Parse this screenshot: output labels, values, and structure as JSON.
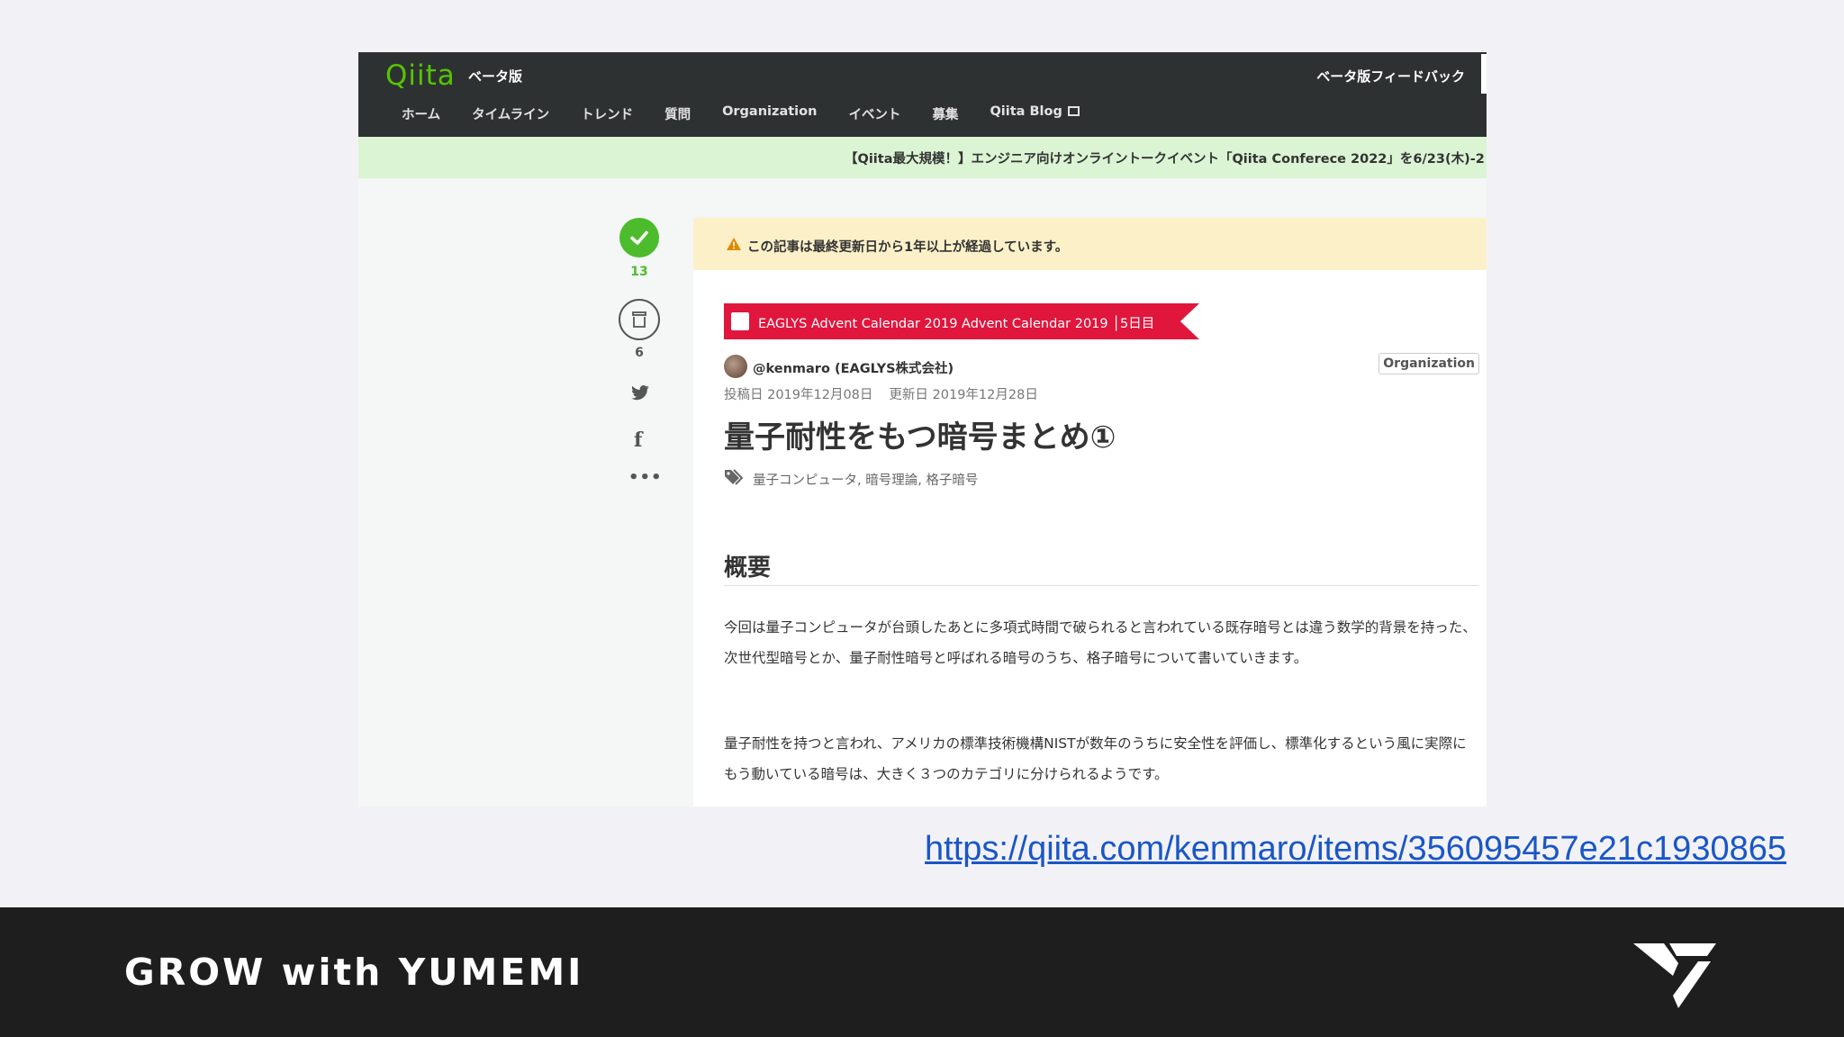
{
  "qiita": {
    "logo": "Qiita",
    "beta": "ベータ版",
    "feedback": "ベータ版フィードバック",
    "nav": [
      "ホーム",
      "タイムライン",
      "トレンド",
      "質問",
      "Organization",
      "イベント",
      "募集",
      "Qiita Blog"
    ],
    "announcement": "【Qiita最大規模！】エンジニア向けオンライントークイベント「Qiita Conferece 2022」を6/23(木)-2"
  },
  "sidebar": {
    "like_count": "13",
    "stock_count": "6"
  },
  "article": {
    "warning": "この記事は最終更新日から1年以上が経過しています。",
    "advent": "EAGLYS Advent Calendar 2019 Advent Calendar 2019 │5日目",
    "author": "@kenmaro (EAGLYS株式会社)",
    "org_badge": "Organization",
    "posted": "投稿日 2019年12月08日",
    "updated": "更新日 2019年12月28日",
    "title": "量子耐性をもつ暗号まとめ①",
    "tags": "量子コンピュータ, 暗号理論, 格子暗号",
    "section_heading": "概要",
    "paragraph1": "今回は量子コンピュータが台頭したあとに多項式時間で破られると言われている既存暗号とは違う数学的背景を持った、次世代型暗号とか、量子耐性暗号と呼ばれる暗号のうち、格子暗号について書いていきます。",
    "paragraph2": "量子耐性を持つと言われ、アメリカの標準技術機構NISTが数年のうちに安全性を評価し、標準化するという風に実際にもう動いている暗号は、大きく３つのカテゴリに分けられるようです。"
  },
  "slide": {
    "url": "https://qiita.com/kenmaro/items/356095457e21c1930865",
    "footer": "GROW with YUMEMI"
  },
  "colors": {
    "qiita_green": "#55c500",
    "like_green": "#4cbc2c",
    "advent_red": "#e0163d",
    "link_blue": "#1a56c6",
    "footer_bg": "#1e1e1e"
  }
}
